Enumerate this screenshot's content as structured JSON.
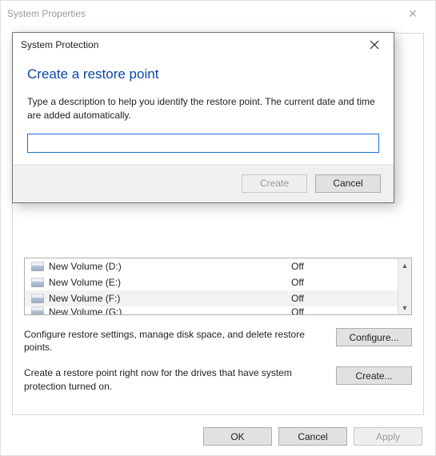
{
  "parent": {
    "title": "System Properties",
    "drives": [
      {
        "name": "New Volume (D:)",
        "status": "Off",
        "alt": false
      },
      {
        "name": "New Volume (E:)",
        "status": "Off",
        "alt": false
      },
      {
        "name": "New Volume (F:)",
        "status": "Off",
        "alt": true
      },
      {
        "name": "New Volume (G:)",
        "status": "Off",
        "alt": false
      }
    ],
    "configure_text": "Configure restore settings, manage disk space, and delete restore points.",
    "configure_button": "Configure...",
    "create_text": "Create a restore point right now for the drives that have system protection turned on.",
    "create_button": "Create...",
    "ok": "OK",
    "cancel": "Cancel",
    "apply": "Apply"
  },
  "dialog": {
    "title": "System Protection",
    "headline": "Create a restore point",
    "description": "Type a description to help you identify the restore point. The current date and time are added automatically.",
    "input_value": "",
    "create": "Create",
    "cancel": "Cancel"
  }
}
